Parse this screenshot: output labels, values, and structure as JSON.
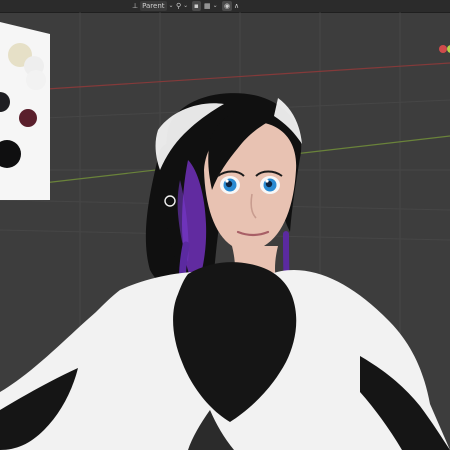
{
  "header": {
    "pivot_label": "Parent",
    "icons": [
      "transform-pivot-icon",
      "snap-icon",
      "snap-increment-icon",
      "proportional-editing-icon",
      "falloff-icon"
    ]
  },
  "colors": {
    "viewport_bg": "#3d3d3d",
    "grid_line": "#4a4a4a",
    "x_axis": "#8c3a3a",
    "y_axis": "#6f8b3a",
    "hair_dark": "#111111",
    "hair_purple": "#6a2fb0",
    "skin": "#e8c2b2",
    "outfit_white": "#f2f2f2",
    "outfit_black": "#151515"
  }
}
